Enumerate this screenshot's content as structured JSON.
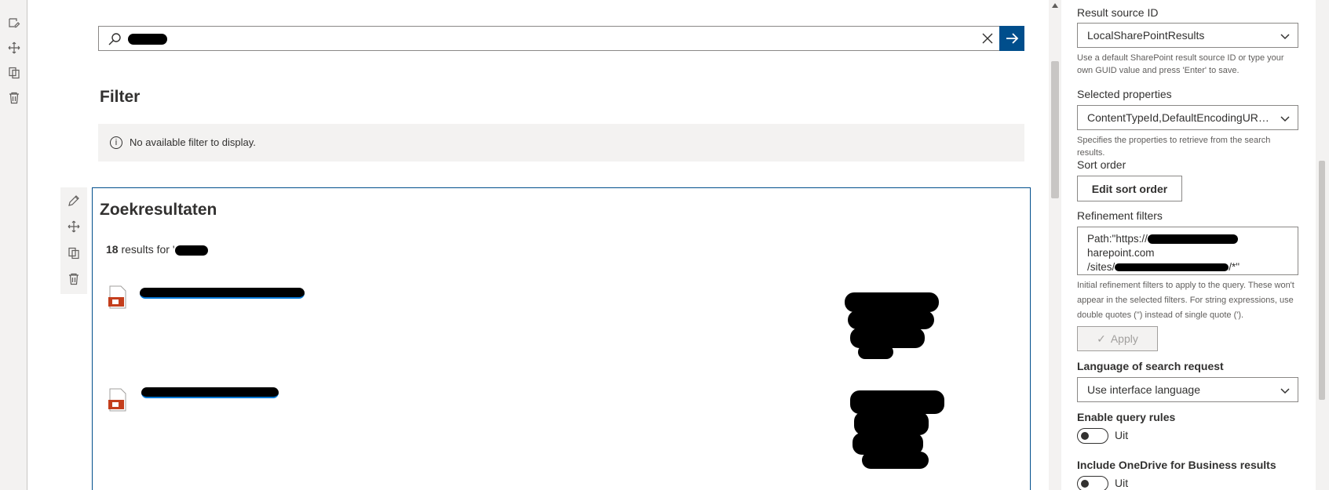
{
  "search": {
    "query_redacted": true
  },
  "filter": {
    "title": "Filter",
    "empty_message": "No available filter to display."
  },
  "results": {
    "title": "Zoekresultaten",
    "count": "18",
    "count_suffix": "results for '",
    "items": [
      {
        "title_redacted": true,
        "icon": "powerpoint-file-icon"
      },
      {
        "title_redacted": true,
        "icon": "powerpoint-file-icon"
      }
    ]
  },
  "pane": {
    "result_source_label": "Result source ID",
    "result_source_value": "LocalSharePointResults",
    "result_source_help": "Use a default SharePoint result source ID or type your own GUID value and press 'Enter' to save.",
    "selected_props_label": "Selected properties",
    "selected_props_value": "ContentTypeId,DefaultEncodingURL,...",
    "selected_props_help": "Specifies the properties to retrieve from the search results.",
    "sort_order_label": "Sort order",
    "sort_order_button": "Edit sort order",
    "refinement_label": "Refinement filters",
    "refinement_line1_prefix": "Path:\"https://",
    "refinement_line1_suffix": "harepoint.com",
    "refinement_line2_prefix": "/sites/",
    "refinement_line2_suffix": "/*\"",
    "refinement_help": "Initial refinement filters to apply to the query. These won't appear in the selected filters. For string expressions, use double quotes (\") instead of single quote (').",
    "apply_button": "Apply",
    "language_label": "Language of search request",
    "language_value": "Use interface language",
    "query_rules_label": "Enable query rules",
    "query_rules_state": "Uit",
    "onedrive_label": "Include OneDrive for Business results",
    "onedrive_state": "Uit"
  },
  "colors": {
    "accent": "#004e8c",
    "link": "#0078d4",
    "neutral": "#f3f2f1"
  }
}
